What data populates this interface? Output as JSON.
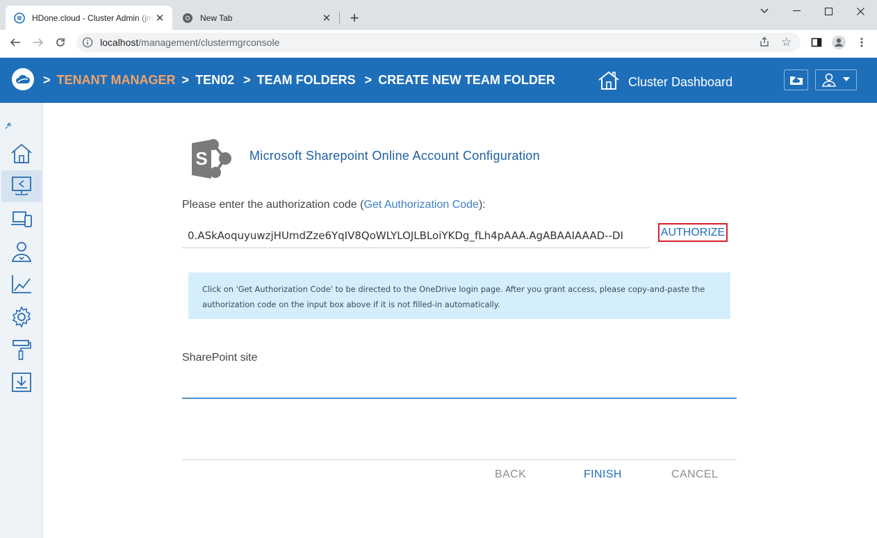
{
  "browser": {
    "tabs": [
      {
        "title": "HDone.cloud - Cluster Admin (jm",
        "active": true
      },
      {
        "title": "New Tab",
        "active": false
      }
    ],
    "url_host": "localhost",
    "url_path": "/management/clustermgrconsole"
  },
  "header": {
    "breadcrumbs": {
      "sep": ">",
      "tenant_manager": "TENANT MANAGER",
      "tenant": "TEN02",
      "team_folders": "TEAM FOLDERS",
      "current": "CREATE NEW TEAM FOLDER"
    },
    "cluster_dashboard": "Cluster Dashboard"
  },
  "sidebar": {
    "items": [
      {
        "icon": "home-icon"
      },
      {
        "icon": "tenant-share-icon",
        "active": true
      },
      {
        "icon": "devices-icon"
      },
      {
        "icon": "users-icon"
      },
      {
        "icon": "chart-icon"
      },
      {
        "icon": "gear-icon"
      },
      {
        "icon": "paint-roller-icon"
      },
      {
        "icon": "download-icon"
      }
    ]
  },
  "form": {
    "title": "Microsoft Sharepoint Online Account Configuration",
    "prompt_prefix": "Please enter the authorization code (",
    "prompt_link": "Get Authorization Code",
    "prompt_suffix": "):",
    "auth_code_value": "0.ASkAoquyuwzjHUmdZze6YqIV8QoWLYLOJLBLoiYKDg_fLh4pAAA.AgABAAIAAAD--DI",
    "authorize_label": "AUTHORIZE",
    "info_text": "Click on 'Get Authorization Code' to be directed to the OneDrive login page. After you grant access, please copy-and-paste the authorization code on the input box above if it is not filled-in automatically.",
    "site_label": "SharePoint site",
    "site_value": ""
  },
  "footer": {
    "back": "BACK",
    "finish": "FINISH",
    "cancel": "CANCEL"
  },
  "colors": {
    "header_bg": "#1e6fba",
    "breadcrumb_accent": "#f0a367",
    "info_bg": "#d5eefb",
    "authorize_outline": "#d6202a"
  }
}
